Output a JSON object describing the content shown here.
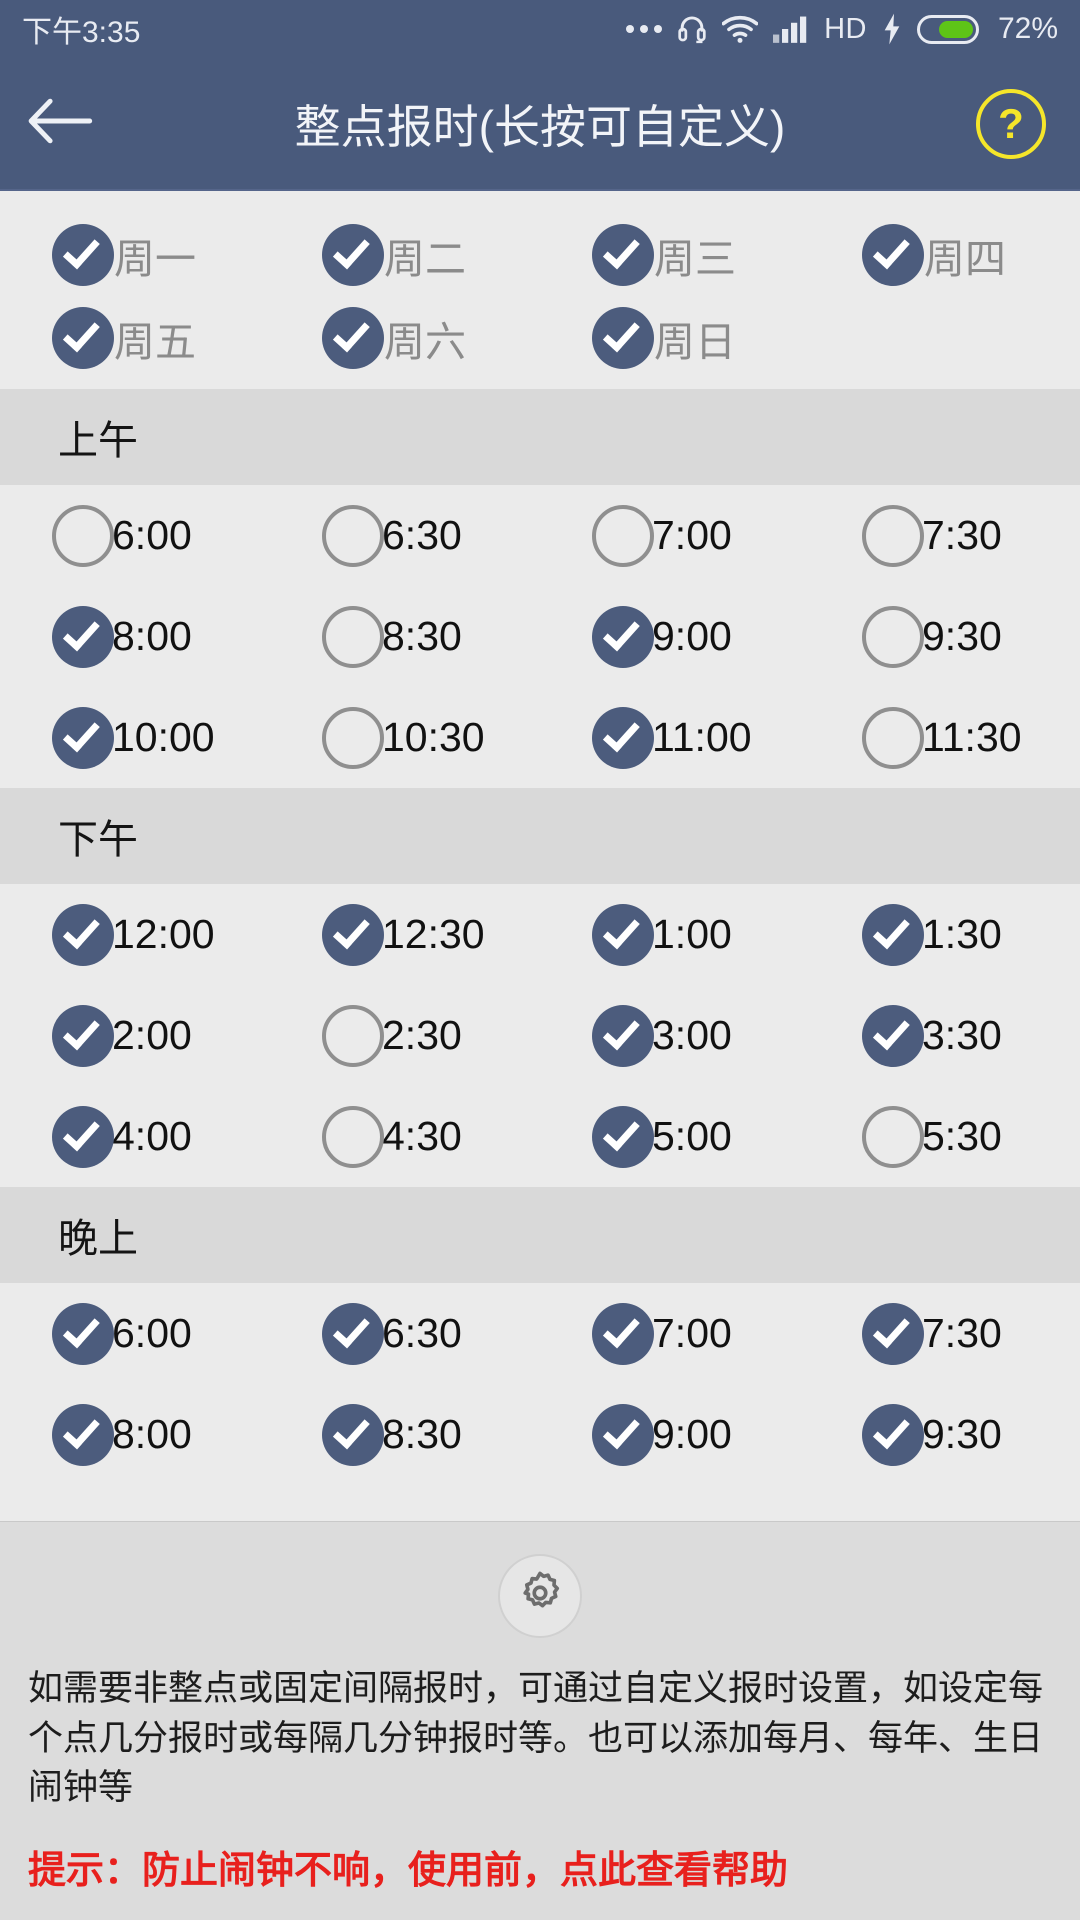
{
  "statusbar": {
    "time": "下午3:35",
    "battery_percent": "72%",
    "network_label": "HD",
    "icons": [
      "more-dots-icon",
      "headset-icon",
      "wifi-icon",
      "signal-icon",
      "charging-bolt-icon",
      "battery-icon"
    ]
  },
  "appbar": {
    "title": "整点报时(长按可自定义)",
    "back_icon": "back-arrow-icon",
    "help_label": "?"
  },
  "weekdays": [
    {
      "label": "周一",
      "checked": true
    },
    {
      "label": "周二",
      "checked": true
    },
    {
      "label": "周三",
      "checked": true
    },
    {
      "label": "周四",
      "checked": true
    },
    {
      "label": "周五",
      "checked": true
    },
    {
      "label": "周六",
      "checked": true
    },
    {
      "label": "周日",
      "checked": true
    }
  ],
  "sections": [
    {
      "title": "上午",
      "times": [
        {
          "label": "6:00",
          "checked": false
        },
        {
          "label": "6:30",
          "checked": false
        },
        {
          "label": "7:00",
          "checked": false
        },
        {
          "label": "7:30",
          "checked": false
        },
        {
          "label": "8:00",
          "checked": true
        },
        {
          "label": "8:30",
          "checked": false
        },
        {
          "label": "9:00",
          "checked": true
        },
        {
          "label": "9:30",
          "checked": false
        },
        {
          "label": "10:00",
          "checked": true
        },
        {
          "label": "10:30",
          "checked": false
        },
        {
          "label": "11:00",
          "checked": true
        },
        {
          "label": "11:30",
          "checked": false
        }
      ]
    },
    {
      "title": "下午",
      "times": [
        {
          "label": "12:00",
          "checked": true
        },
        {
          "label": "12:30",
          "checked": true
        },
        {
          "label": "1:00",
          "checked": true
        },
        {
          "label": "1:30",
          "checked": true
        },
        {
          "label": "2:00",
          "checked": true
        },
        {
          "label": "2:30",
          "checked": false
        },
        {
          "label": "3:00",
          "checked": true
        },
        {
          "label": "3:30",
          "checked": true
        },
        {
          "label": "4:00",
          "checked": true
        },
        {
          "label": "4:30",
          "checked": false
        },
        {
          "label": "5:00",
          "checked": true
        },
        {
          "label": "5:30",
          "checked": false
        }
      ]
    },
    {
      "title": "晚上",
      "times": [
        {
          "label": "6:00",
          "checked": true
        },
        {
          "label": "6:30",
          "checked": true
        },
        {
          "label": "7:00",
          "checked": true
        },
        {
          "label": "7:30",
          "checked": true
        },
        {
          "label": "8:00",
          "checked": true
        },
        {
          "label": "8:30",
          "checked": true
        },
        {
          "label": "9:00",
          "checked": true
        },
        {
          "label": "9:30",
          "checked": true
        }
      ]
    }
  ],
  "footer": {
    "gear_icon": "gear-icon",
    "description": "如需要非整点或固定间隔报时，可通过自定义报时设置，如设定每个点几分报时或每隔几分钟报时等。也可以添加每月、每年、生日闹钟等",
    "warning": "提示：防止闹钟不响，使用前，点此查看帮助"
  },
  "colors": {
    "header_blue": "#495a7c",
    "check_fill": "#4c5c7d",
    "accent_yellow": "#f5e62a",
    "warning_red": "#e8201d",
    "battery_green": "#5ec417",
    "section_bg": "#d9d9d9",
    "content_bg": "#ebebeb"
  }
}
